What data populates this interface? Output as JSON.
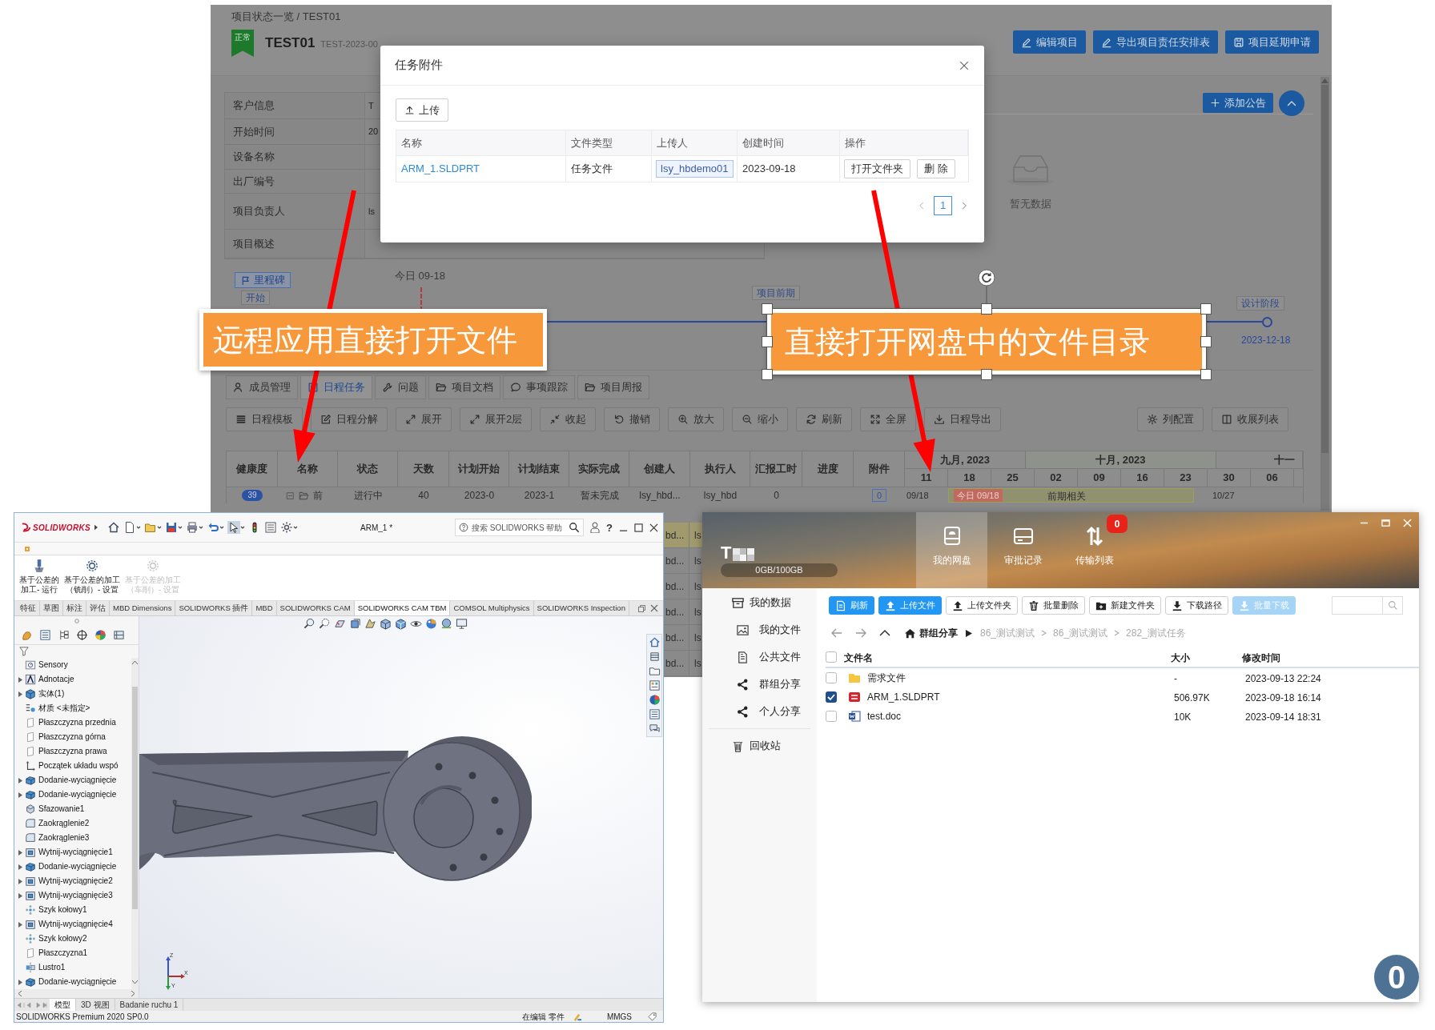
{
  "project_page": {
    "breadcrumb": "项目状态一览 / TEST01",
    "status_flag": "正常",
    "title": "TEST01",
    "code": "TEST-2023-00",
    "header_buttons": [
      {
        "label": "编辑项目",
        "kind": "edit"
      },
      {
        "label": "导出项目责任安排表",
        "kind": "edit"
      },
      {
        "label": "项目延期申请",
        "kind": "save"
      }
    ],
    "info_rows": [
      {
        "label": "客户信息",
        "value": "T"
      },
      {
        "label": "开始时间",
        "value": "20"
      },
      {
        "label": "设备名称"
      },
      {
        "label": "出厂编号"
      },
      {
        "label": "项目负责人",
        "value": "ls"
      },
      {
        "label": "项目概述"
      }
    ],
    "notice": {
      "add_button": "添加公告",
      "empty_text": "暂无数据"
    },
    "milestones": {
      "button": "里程碑",
      "today": "今日 09-18",
      "stages": [
        {
          "label": "开始"
        },
        {
          "label": "项目前期"
        },
        {
          "label": "设计阶段",
          "date": "2023-12-18"
        }
      ]
    },
    "tabs": [
      {
        "label": "成员管理",
        "kind": "members",
        "selected": false
      },
      {
        "label": "日程任务",
        "kind": "schedule",
        "selected": true
      },
      {
        "label": "问题",
        "kind": "issue",
        "selected": false
      },
      {
        "label": "项目文档",
        "kind": "folder",
        "selected": false
      },
      {
        "label": "事项跟踪",
        "kind": "chat",
        "selected": false
      },
      {
        "label": "项目周报",
        "kind": "folder",
        "selected": false
      }
    ],
    "toolbar": [
      {
        "label": "日程模板",
        "kind": "template"
      },
      {
        "label": "日程分解",
        "kind": "decompose"
      },
      {
        "label": "展开",
        "kind": "expand"
      },
      {
        "label": "展开2层",
        "kind": "expand"
      },
      {
        "label": "收起",
        "kind": "collapse"
      },
      {
        "label": "撤销",
        "kind": "undo"
      },
      {
        "label": "放大",
        "kind": "zoom_in"
      },
      {
        "label": "缩小",
        "kind": "zoom_out"
      },
      {
        "label": "刷新",
        "kind": "refresh"
      },
      {
        "label": "全屏",
        "kind": "fullscreen"
      },
      {
        "label": "日程导出",
        "kind": "export"
      }
    ],
    "toolbar_right": [
      {
        "label": "列配置",
        "kind": "settings"
      },
      {
        "label": "收展列表",
        "kind": "columns"
      }
    ],
    "table": {
      "columns": [
        "健康度",
        "名称",
        "状态",
        "天数",
        "计划开始",
        "计划结束",
        "实际完成",
        "创建人",
        "执行人",
        "汇报工时",
        "进度",
        "附件"
      ],
      "gantt_months": [
        "九月, 2023",
        "十月, 2023",
        "十一"
      ],
      "gantt_weeks": [
        "11",
        "18",
        "25",
        "02",
        "09",
        "16",
        "23",
        "30",
        "06"
      ],
      "rows": [
        {
          "health": "39",
          "name": "前",
          "status": "进行中",
          "days": "40",
          "plan_start": "2023-0",
          "plan_end": "2023-1",
          "actual": "暂未完成",
          "creator": "lsy_hbd...",
          "executor": "lsy_hbd",
          "hours": "0",
          "attachments": "0",
          "bar_start": "09/18",
          "today_label": "今日 09/18",
          "bar_label": "前期相关",
          "bar_end": "10/27"
        }
      ],
      "row_fragments": [
        {
          "cells": [
            "bd...",
            "ls"
          ],
          "color": "#a09a6e"
        },
        {
          "cells": [
            "bd...",
            "ls"
          ],
          "color": "#8a8a8a"
        },
        {
          "cells": [
            "bd...",
            "ls"
          ],
          "color": "#8a8a8a"
        },
        {
          "cells": [
            "bd...",
            "ls"
          ],
          "color": "#8a8a8a"
        },
        {
          "cells": [
            "bd...",
            "ls"
          ],
          "color": "#8a8a8a"
        },
        {
          "cells": [
            "bd...",
            "ls"
          ],
          "color": "#8a8a8a"
        }
      ]
    }
  },
  "attachment_dialog": {
    "title": "任务附件",
    "upload_button": "上传",
    "columns": [
      "名称",
      "文件类型",
      "上传人",
      "创建时间",
      "操作"
    ],
    "rows": [
      {
        "name": "ARM_1.SLDPRT",
        "type": "任务文件",
        "uploader": "lsy_hbdemo01",
        "created": "2023-09-18",
        "actions": [
          "打开文件夹",
          "删 除"
        ]
      }
    ],
    "pages": [
      {
        "label": "1",
        "selected": true
      }
    ]
  },
  "callouts": [
    {
      "text": "远程应用直接打开文件",
      "selected": false
    },
    {
      "text": "直接打开网盘中的文件目录",
      "selected": true
    }
  ],
  "solidworks": {
    "logo": "SOLIDWORKS",
    "document_title": "ARM_1 *",
    "search_placeholder": "搜索 SOLIDWORKS 帮助",
    "help_label": "?",
    "commands": [
      {
        "label": "基于公差的加工- 运行",
        "kind": "run",
        "disabled": false
      },
      {
        "label": "基于公差的加工（铣削）- 设置",
        "kind": "setup",
        "disabled": false
      },
      {
        "label": "基于公差的加工（车削）- 设置",
        "kind": "setup",
        "disabled": true
      }
    ],
    "tabs": [
      {
        "label": "特征",
        "selected": false
      },
      {
        "label": "草图",
        "selected": false
      },
      {
        "label": "标注",
        "selected": false
      },
      {
        "label": "评估",
        "selected": false
      },
      {
        "label": "MBD Dimensions",
        "selected": false
      },
      {
        "label": "SOLIDWORKS 插件",
        "selected": false
      },
      {
        "label": "MBD",
        "selected": false
      },
      {
        "label": "SOLIDWORKS CAM",
        "selected": false
      },
      {
        "label": "SOLIDWORKS CAM TBM",
        "selected": true
      },
      {
        "label": "COMSOL Multiphysics",
        "selected": false
      },
      {
        "label": "SOLIDWORKS Inspection",
        "selected": false
      }
    ],
    "tree": [
      {
        "label": "Sensory",
        "kind": "sensor",
        "expandable": false
      },
      {
        "label": "Adnotacje",
        "kind": "annotation",
        "expandable": true
      },
      {
        "label": "实体(1)",
        "kind": "body",
        "expandable": true
      },
      {
        "label": "材质 <未指定>",
        "kind": "material",
        "expandable": false
      },
      {
        "label": "Płaszczyzna przednia",
        "kind": "plane",
        "expandable": false
      },
      {
        "label": "Płaszczyzna górna",
        "kind": "plane",
        "expandable": false
      },
      {
        "label": "Płaszczyzna prawa",
        "kind": "plane",
        "expandable": false
      },
      {
        "label": "Początek układu wspó",
        "kind": "origin",
        "expandable": false
      },
      {
        "label": "Dodanie-wyciągnięcie",
        "kind": "boss",
        "expandable": true
      },
      {
        "label": "Dodanie-wyciągnięcie",
        "kind": "boss",
        "expandable": true
      },
      {
        "label": "Sfazowanie1",
        "kind": "chamfer",
        "expandable": false
      },
      {
        "label": "Zaokrąglenie2",
        "kind": "fillet",
        "expandable": false
      },
      {
        "label": "Zaokrąglenie3",
        "kind": "fillet",
        "expandable": false
      },
      {
        "label": "Wytnij-wyciągnięcie1",
        "kind": "cut",
        "expandable": true
      },
      {
        "label": "Dodanie-wyciągnięcie",
        "kind": "boss",
        "expandable": true
      },
      {
        "label": "Wytnij-wyciągnięcie2",
        "kind": "cut",
        "expandable": true
      },
      {
        "label": "Wytnij-wyciągnięcie3",
        "kind": "cut",
        "expandable": true
      },
      {
        "label": "Szyk kołowy1",
        "kind": "pattern",
        "expandable": false
      },
      {
        "label": "Wytnij-wyciągnięcie4",
        "kind": "cut",
        "expandable": true
      },
      {
        "label": "Szyk kołowy2",
        "kind": "pattern",
        "expandable": false
      },
      {
        "label": "Płaszczyzna1",
        "kind": "plane",
        "expandable": false
      },
      {
        "label": "Lustro1",
        "kind": "mirror",
        "expandable": false
      },
      {
        "label": "Dodanie-wyciągnięcie",
        "kind": "boss",
        "expandable": true
      }
    ],
    "axes": [
      "Z",
      "X",
      "Y"
    ],
    "bottom_tabs": [
      {
        "label": "模型",
        "selected": true
      },
      {
        "label": "3D 视图",
        "selected": false
      },
      {
        "label": "Badanie ruchu 1",
        "selected": false
      }
    ],
    "status_bar": {
      "product": "SOLIDWORKS Premium 2020 SP0.0",
      "mode": "在编辑 零件",
      "units": "MMGS"
    }
  },
  "netdisk": {
    "logo_letter": "T",
    "storage": "0GB/100GB",
    "nav": [
      {
        "label": "我的网盘",
        "kind": "drive",
        "selected": true
      },
      {
        "label": "审批记录",
        "kind": "record",
        "selected": false
      },
      {
        "label": "传输列表",
        "kind": "transfer",
        "selected": false,
        "badge": "0"
      }
    ],
    "sidebar": [
      {
        "label": "我的数据",
        "kind": "box",
        "children": [
          {
            "label": "我的文件",
            "kind": "image"
          },
          {
            "label": "公共文件",
            "kind": "document"
          },
          {
            "label": "群组分享",
            "kind": "share"
          },
          {
            "label": "个人分享",
            "kind": "share"
          }
        ]
      },
      {
        "label": "回收站",
        "kind": "trash"
      }
    ],
    "toolbar": [
      {
        "label": "刷新",
        "kind": "document",
        "primary": true,
        "disabled": false
      },
      {
        "label": "上传文件",
        "kind": "upload",
        "primary": true,
        "disabled": false
      },
      {
        "label": "上传文件夹",
        "kind": "upload",
        "primary": false,
        "disabled": false
      },
      {
        "label": "批量删除",
        "kind": "delete",
        "primary": false,
        "disabled": false
      },
      {
        "label": "新建文件夹",
        "kind": "new_folder",
        "primary": false,
        "disabled": false
      },
      {
        "label": "下载路径",
        "kind": "download",
        "primary": false,
        "disabled": false
      },
      {
        "label": "批量下载",
        "kind": "download",
        "primary": true,
        "disabled": true
      }
    ],
    "path_root": "群组分享",
    "path": [
      "86_测试测试",
      "86_测试测试",
      "282_测试任务"
    ],
    "columns": [
      "文件名",
      "大小",
      "修改时间"
    ],
    "all_checked": false,
    "files": [
      {
        "name": "需求文件",
        "kind": "folder",
        "size": "-",
        "modified": "2023-09-13 22:24",
        "checked": false
      },
      {
        "name": "ARM_1.SLDPRT",
        "kind": "sldprt",
        "size": "506.97K",
        "modified": "2023-09-18 16:14",
        "checked": true
      },
      {
        "name": "test.doc",
        "kind": "word",
        "size": "10K",
        "modified": "2023-09-14 18:31",
        "checked": false
      }
    ]
  },
  "floating_counter": "0"
}
